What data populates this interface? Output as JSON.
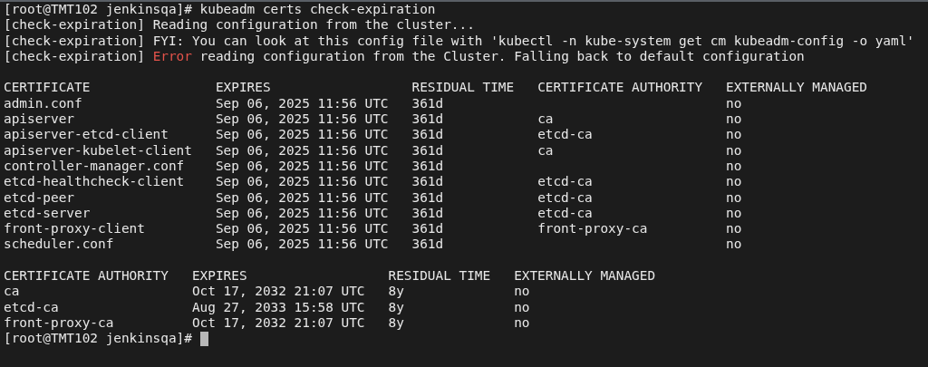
{
  "prompt": "[root@TMT102 jenkinsqa]#",
  "command": "kubeadm certs check-expiration",
  "messages": [
    {
      "kind": "info",
      "prefix": "[check-expiration]",
      "text": "Reading configuration from the cluster..."
    },
    {
      "kind": "info",
      "prefix": "[check-expiration]",
      "text": "FYI: You can look at this config file with 'kubectl -n kube-system get cm kubeadm-config -o yaml'"
    },
    {
      "kind": "error",
      "prefix": "[check-expiration]",
      "label": "Error",
      "text": "reading configuration from the Cluster. Falling back to default configuration"
    }
  ],
  "tables": [
    {
      "columns": [
        "CERTIFICATE",
        "EXPIRES",
        "RESIDUAL TIME",
        "CERTIFICATE AUTHORITY",
        "EXTERNALLY MANAGED"
      ],
      "rows": [
        {
          "name": "admin.conf",
          "expires": "Sep 06, 2025 11:56 UTC",
          "residual_time": "361d",
          "externally_managed": "no"
        },
        {
          "name": "apiserver",
          "expires": "Sep 06, 2025 11:56 UTC",
          "residual_time": "361d",
          "certificate_authority": "ca",
          "externally_managed": "no"
        },
        {
          "name": "apiserver-etcd-client",
          "expires": "Sep 06, 2025 11:56 UTC",
          "residual_time": "361d",
          "certificate_authority": "etcd-ca",
          "externally_managed": "no"
        },
        {
          "name": "apiserver-kubelet-client",
          "expires": "Sep 06, 2025 11:56 UTC",
          "residual_time": "361d",
          "certificate_authority": "ca",
          "externally_managed": "no"
        },
        {
          "name": "controller-manager.conf",
          "expires": "Sep 06, 2025 11:56 UTC",
          "residual_time": "361d",
          "externally_managed": "no"
        },
        {
          "name": "etcd-healthcheck-client",
          "expires": "Sep 06, 2025 11:56 UTC",
          "residual_time": "361d",
          "certificate_authority": "etcd-ca",
          "externally_managed": "no"
        },
        {
          "name": "etcd-peer",
          "expires": "Sep 06, 2025 11:56 UTC",
          "residual_time": "361d",
          "certificate_authority": "etcd-ca",
          "externally_managed": "no"
        },
        {
          "name": "etcd-server",
          "expires": "Sep 06, 2025 11:56 UTC",
          "residual_time": "361d",
          "certificate_authority": "etcd-ca",
          "externally_managed": "no"
        },
        {
          "name": "front-proxy-client",
          "expires": "Sep 06, 2025 11:56 UTC",
          "residual_time": "361d",
          "certificate_authority": "front-proxy-ca",
          "externally_managed": "no"
        },
        {
          "name": "scheduler.conf",
          "expires": "Sep 06, 2025 11:56 UTC",
          "residual_time": "361d",
          "externally_managed": "no"
        }
      ]
    },
    {
      "columns": [
        "CERTIFICATE AUTHORITY",
        "EXPIRES",
        "RESIDUAL TIME",
        "EXTERNALLY MANAGED"
      ],
      "rows": [
        {
          "name": "ca",
          "expires": "Oct 17, 2032 21:07 UTC",
          "residual_time": "8y",
          "externally_managed": "no"
        },
        {
          "name": "etcd-ca",
          "expires": "Aug 27, 2033 15:58 UTC",
          "residual_time": "8y",
          "externally_managed": "no"
        },
        {
          "name": "front-proxy-ca",
          "expires": "Oct 17, 2032 21:07 UTC",
          "residual_time": "8y",
          "externally_managed": "no"
        }
      ]
    }
  ],
  "final_prompt": "[root@TMT102 jenkinsqa]#"
}
